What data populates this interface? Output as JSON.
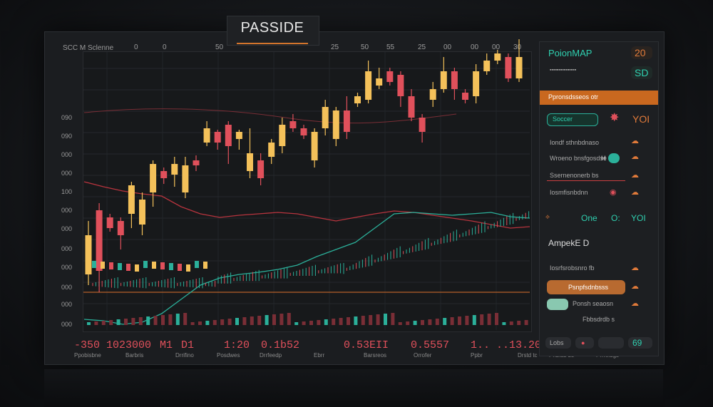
{
  "header": {
    "title": "PASSIDE"
  },
  "chart": {
    "corner_label": "SCC M Sclenne",
    "top_ticks": [
      "0",
      "0",
      "50",
      "25",
      "50",
      "55",
      "25",
      "00",
      "00",
      "00",
      "30"
    ],
    "y_ticks": [
      "090",
      "090",
      "000",
      "000",
      "100",
      "000",
      "000",
      "000",
      "000",
      "000",
      "000",
      "000"
    ],
    "bottom_values": [
      "-350 102",
      "3000",
      "M1",
      "D1",
      "1:20",
      "0.1b52",
      "0.53EII",
      "0.5557",
      "1.. ..13.20"
    ],
    "bottom_labels": [
      "Ppobisbne",
      "Barbris",
      "Drrifino",
      "Posdwes",
      "Drrfeedp",
      "Ebrr",
      "Barsreos",
      "Orrofer",
      "Ppbr",
      "Drstd tc",
      "Pnblas bs",
      "Prrfeidgs"
    ]
  },
  "panel": {
    "header_left": "PoionMAP",
    "header_right": "20",
    "sub_right": "SD",
    "orange_bar": "Ppronsdsseos otr",
    "badge": "Soccer",
    "yoi": "YOI",
    "rows": [
      "Iondf sthnbdnaso",
      "Wroeno bnsfgosdse",
      "Ssernenonerb bs",
      "Iosmfisnbdnn"
    ],
    "ratio_right": "H",
    "one": "One",
    "ok": "O:",
    "yoi2": "YOI",
    "section": "AmpekE D",
    "rows2": [
      "Iosrfsrobsnro fb",
      "Psnpfsdnbsss",
      "Ponsh seaosn",
      "Fbbsdrdb s"
    ],
    "footer_left": "Lobs",
    "footer_right": "69"
  },
  "colors": {
    "bull": "#f4c15a",
    "bear": "#e0505b",
    "green": "#2bb09a",
    "accent": "#d4752c"
  },
  "chart_data": {
    "type": "candlestick",
    "title": "PASSIDE",
    "candles": [
      {
        "o": 385,
        "c": 330,
        "h": 400,
        "l": 310
      },
      {
        "o": 295,
        "c": 380,
        "h": 410,
        "l": 285
      },
      {
        "o": 305,
        "c": 320,
        "h": 325,
        "l": 300
      },
      {
        "o": 310,
        "c": 330,
        "h": 350,
        "l": 305
      },
      {
        "o": 300,
        "c": 260,
        "h": 320,
        "l": 255
      },
      {
        "o": 315,
        "c": 280,
        "h": 330,
        "l": 270
      },
      {
        "o": 270,
        "c": 230,
        "h": 290,
        "l": 225
      },
      {
        "o": 240,
        "c": 250,
        "h": 258,
        "l": 235
      },
      {
        "o": 245,
        "c": 230,
        "h": 262,
        "l": 220
      },
      {
        "o": 270,
        "c": 232,
        "h": 278,
        "l": 220
      },
      {
        "o": 225,
        "c": 232,
        "h": 240,
        "l": 218
      },
      {
        "o": 200,
        "c": 180,
        "h": 205,
        "l": 170
      },
      {
        "o": 185,
        "c": 200,
        "h": 210,
        "l": 182
      },
      {
        "o": 175,
        "c": 205,
        "h": 230,
        "l": 170
      },
      {
        "o": 195,
        "c": 185,
        "h": 210,
        "l": 182
      },
      {
        "o": 240,
        "c": 215,
        "h": 250,
        "l": 180
      },
      {
        "o": 225,
        "c": 250,
        "h": 260,
        "l": 215
      },
      {
        "o": 220,
        "c": 200,
        "h": 230,
        "l": 195
      },
      {
        "o": 205,
        "c": 175,
        "h": 215,
        "l": 165
      },
      {
        "o": 170,
        "c": 180,
        "h": 185,
        "l": 160
      },
      {
        "o": 180,
        "c": 190,
        "h": 195,
        "l": 175
      },
      {
        "o": 225,
        "c": 185,
        "h": 235,
        "l": 180
      },
      {
        "o": 180,
        "c": 150,
        "h": 190,
        "l": 140
      },
      {
        "o": 195,
        "c": 155,
        "h": 205,
        "l": 150
      },
      {
        "o": 155,
        "c": 185,
        "h": 195,
        "l": 135
      },
      {
        "o": 145,
        "c": 135,
        "h": 150,
        "l": 130
      },
      {
        "o": 140,
        "c": 100,
        "h": 145,
        "l": 85
      },
      {
        "o": 120,
        "c": 110,
        "h": 125,
        "l": 95
      },
      {
        "o": 100,
        "c": 115,
        "h": 120,
        "l": 95
      },
      {
        "o": 105,
        "c": 135,
        "h": 150,
        "l": 100
      },
      {
        "o": 135,
        "c": 165,
        "h": 170,
        "l": 125
      },
      {
        "o": 165,
        "c": 185,
        "h": 200,
        "l": 160
      },
      {
        "o": 140,
        "c": 125,
        "h": 150,
        "l": 115
      },
      {
        "o": 125,
        "c": 100,
        "h": 130,
        "l": 80
      },
      {
        "o": 100,
        "c": 125,
        "h": 140,
        "l": 95
      },
      {
        "o": 130,
        "c": 140,
        "h": 145,
        "l": 125
      },
      {
        "o": 135,
        "c": 100,
        "h": 145,
        "l": 90
      },
      {
        "o": 100,
        "c": 85,
        "h": 105,
        "l": 75
      },
      {
        "o": 85,
        "c": 75,
        "h": 90,
        "l": 70
      },
      {
        "o": 80,
        "c": 110,
        "h": 115,
        "l": 75
      },
      {
        "o": 110,
        "c": 80,
        "h": 115,
        "l": 55
      }
    ],
    "line_red": [
      255,
      262,
      268,
      272,
      275,
      290,
      300,
      305,
      302,
      300,
      298,
      300,
      305,
      310,
      305,
      300,
      296,
      298,
      302,
      306,
      310,
      315,
      320,
      318
    ],
    "line_green": [
      448,
      450,
      455,
      452,
      440,
      420,
      400,
      390,
      385,
      382,
      378,
      372,
      360,
      350,
      340,
      320,
      300,
      298,
      300,
      302,
      300,
      298,
      304,
      306
    ]
  }
}
